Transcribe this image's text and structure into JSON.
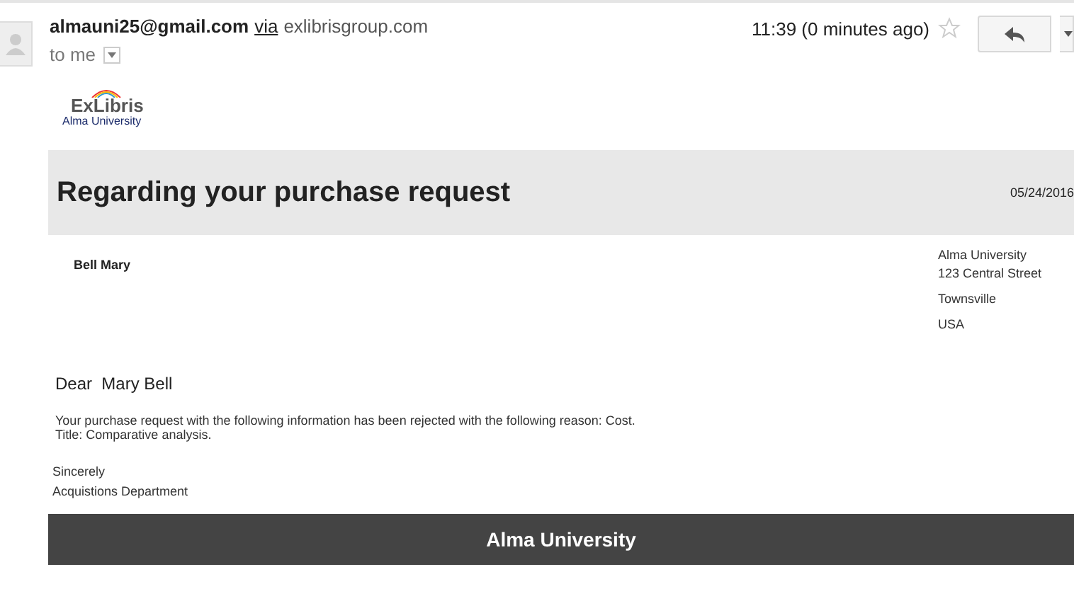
{
  "header": {
    "sender": "almauni25@gmail.com",
    "via": "via",
    "domain": "exlibrisgroup.com",
    "recipient": "to me",
    "time": "11:39 (0 minutes ago)",
    "starred": false
  },
  "logo": {
    "brand": "ExLibris",
    "institution": "Alma University"
  },
  "banner": {
    "title": "Regarding your purchase request",
    "date": "05/24/2016"
  },
  "recipient_name": "Bell Mary",
  "address": [
    "Alma University",
    "123 Central Street",
    "Townsville",
    "USA"
  ],
  "greeting": "Dear  Mary Bell",
  "message": [
    "Your purchase request with the following information has been rejected with the following reason: Cost.",
    "Title: Comparative analysis."
  ],
  "signature": [
    "Sincerely",
    "Acquistions Department"
  ],
  "footer": "Alma University"
}
